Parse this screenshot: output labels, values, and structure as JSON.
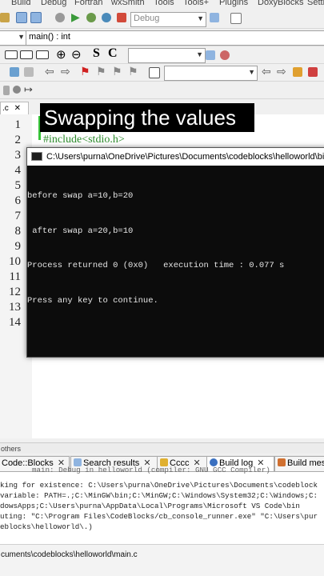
{
  "menubar": [
    "Build",
    "Debug",
    "Fortran",
    "wxSmith",
    "Tools",
    "Tools+",
    "Plugins",
    "DoxyBlocks",
    "Setti"
  ],
  "toolbar": {
    "build_target": "Debug",
    "scope_value": "",
    "function_value": "main() : int",
    "zoom_in_label": "Zoom in",
    "code_s": "S",
    "code_c": "C"
  },
  "editor": {
    "file_tab": ".c",
    "line_numbers": [
      "1",
      "2",
      "3",
      "4",
      "5",
      "6",
      "7",
      "8",
      "9",
      "10",
      "11",
      "12",
      "13",
      "14"
    ],
    "include_text": "#include<stdio.h>",
    "caption": "Swapping the values"
  },
  "console": {
    "title": "C:\\Users\\purna\\OneDrive\\Pictures\\Documents\\codeblocks\\helloworld\\bin\\",
    "lines": [
      "before swap a=10,b=20",
      " after swap a=20,b=10",
      "Process returned 0 (0x0)   execution time : 0.077 s",
      "Press any key to continue."
    ]
  },
  "logs": {
    "others_label": "others",
    "tabs": [
      {
        "label": "Code::Blocks"
      },
      {
        "label": "Search results"
      },
      {
        "label": "Cccc"
      },
      {
        "label": "Build log"
      },
      {
        "label": "Build mes"
      }
    ],
    "partial_line": "main: Debug in helloworld (compiler: GNU GCC Compiler)",
    "lines": [
      "king for existence: C:\\Users\\purna\\OneDrive\\Pictures\\Documents\\codeblock",
      "variable: PATH=.;C:\\MinGW\\bin;C:\\MinGW;C:\\Windows\\System32;C:\\Windows;C:",
      "dowsApps;C:\\Users\\purna\\AppData\\Local\\Programs\\Microsoft VS Code\\bin",
      "uting: \"C:\\Program Files\\CodeBlocks/cb_console_runner.exe\" \"C:\\Users\\pur",
      "eblocks\\helloworld\\.)"
    ]
  },
  "status": {
    "path": "cuments\\codeblocks\\helloworld\\main.c"
  },
  "colors": {
    "console_bg": "#0c0c0c",
    "caption_bg": "#000000",
    "include_green": "#2a8a2a",
    "change_bar": "#39c43a"
  }
}
